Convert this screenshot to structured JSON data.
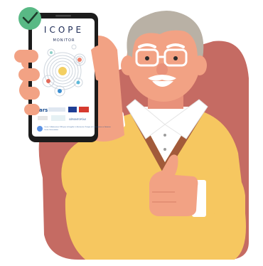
{
  "app": {
    "title": "ICOPE",
    "subtitle": "MONITOR"
  },
  "footer_logos": {
    "ars": "ars",
    "cu_text": "Centre Universitaire",
    "gerontopole": "GÉRONTOPÔLE",
    "who_text": "Centre Collaborateur OMS pour la Fragilité, la Recherche Clinique et la Formation en Gériatrie"
  },
  "colors": {
    "background_shape": "#c56b63",
    "sweater": "#f6c760",
    "skin": "#f2a284",
    "hair": "#b9b1a5",
    "phone": "#1c1c1c",
    "check_badge": "#59b985"
  },
  "icons": {
    "check_badge": "check-icon",
    "thumb": "thumbs-up"
  }
}
